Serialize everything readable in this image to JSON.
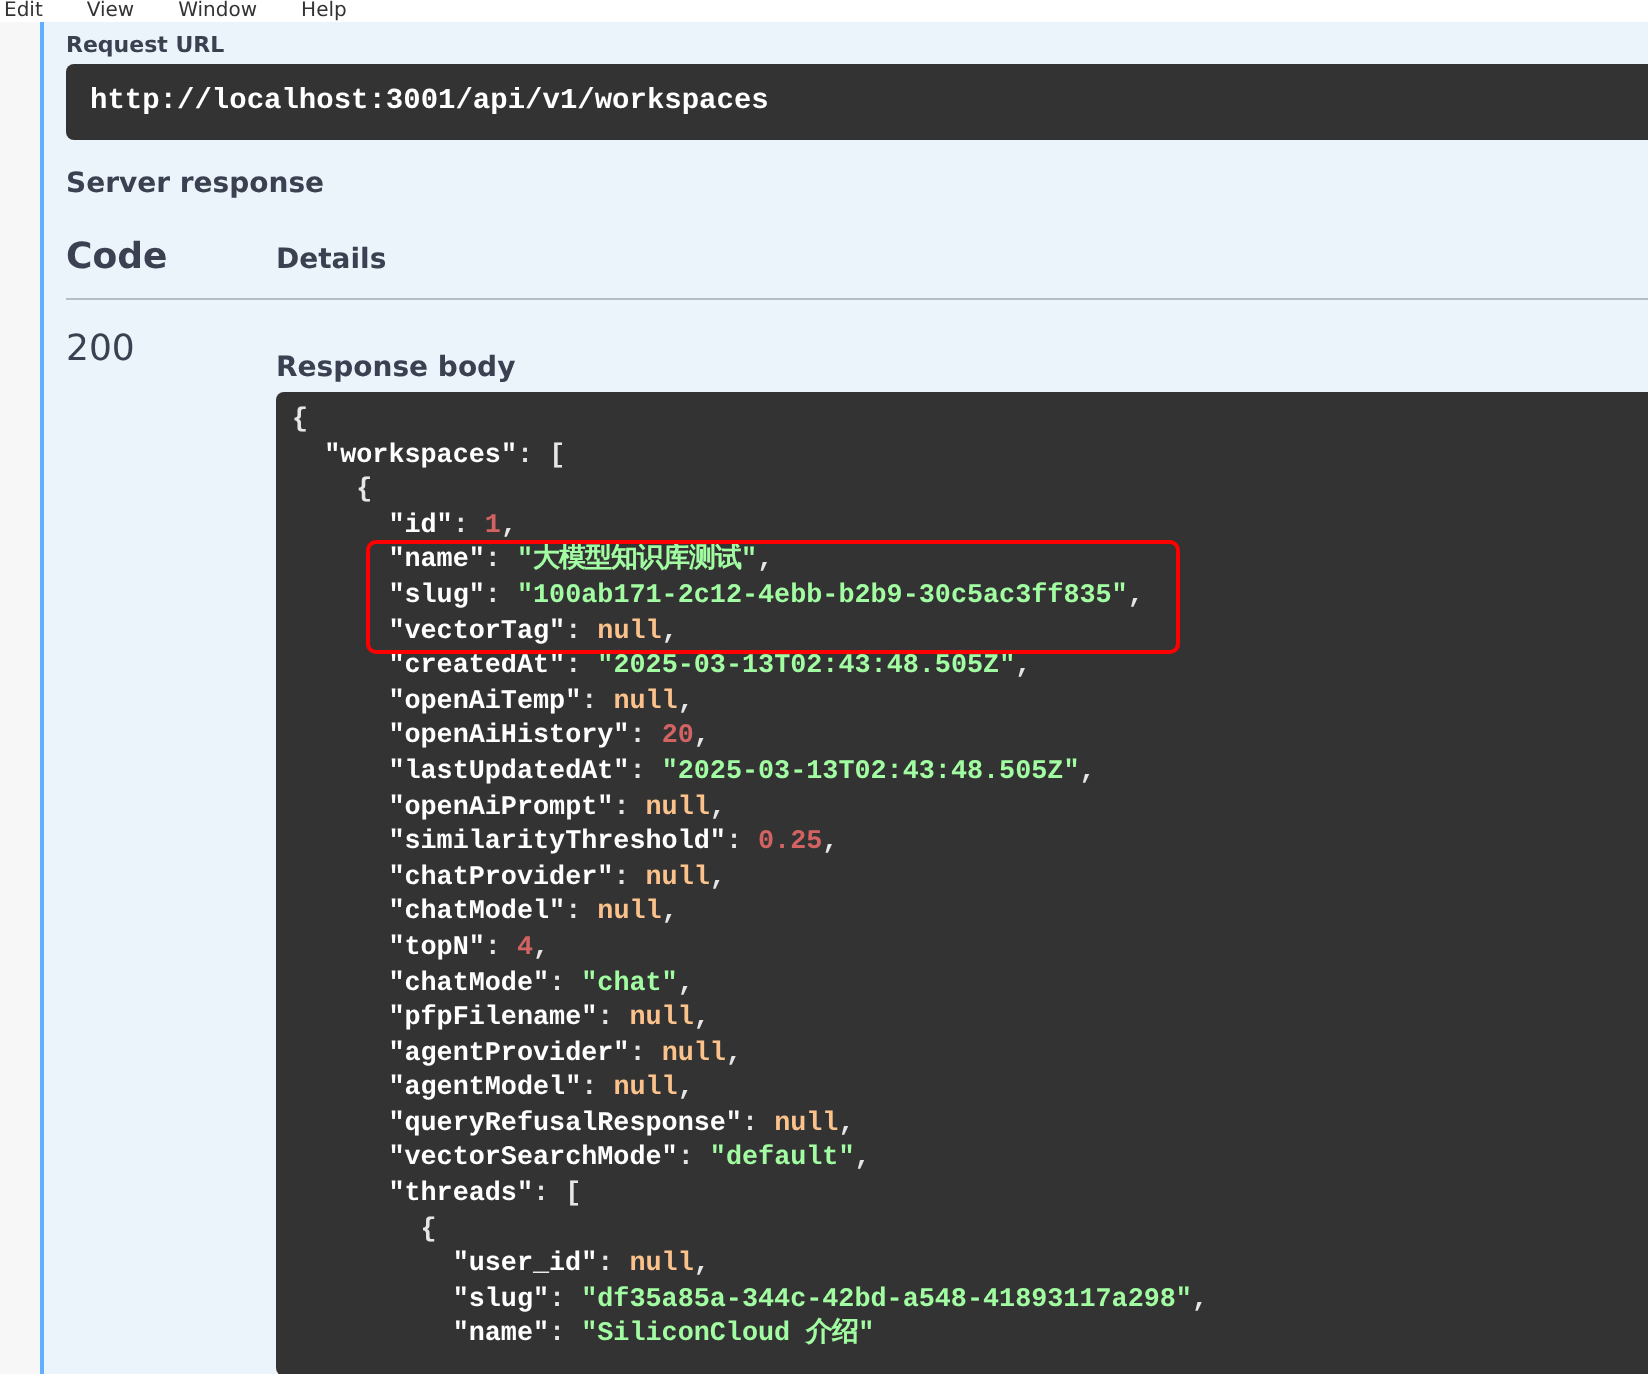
{
  "menu": [
    "Edit",
    "View",
    "Window",
    "Help"
  ],
  "request_url": {
    "label": "Request URL",
    "value": "http://localhost:3001/api/v1/workspaces"
  },
  "server_response": {
    "title": "Server response",
    "columns": [
      "Code",
      "Details"
    ],
    "rows": [
      {
        "code": "200",
        "body_label": "Response body",
        "body": [
          {
            "tokens": [
              {
                "kind": "punct",
                "text": "{"
              }
            ],
            "children": [
              {
                "tokens": [
                  {
                    "kind": "key",
                    "text": "\"workspaces\""
                  },
                  {
                    "kind": "punct",
                    "text": ": ["
                  }
                ],
                "children": [
                  {
                    "tokens": [
                      {
                        "kind": "punct",
                        "text": "{"
                      }
                    ],
                    "children": [
                      {
                        "tokens": [
                          {
                            "kind": "key",
                            "text": "\"id\""
                          },
                          {
                            "kind": "punct",
                            "text": ": "
                          },
                          {
                            "kind": "number",
                            "text": "1"
                          },
                          {
                            "kind": "punct",
                            "text": ","
                          }
                        ],
                        "highlight": false
                      },
                      {
                        "tokens": [
                          {
                            "kind": "key",
                            "text": "\"name\""
                          },
                          {
                            "kind": "punct",
                            "text": ": "
                          },
                          {
                            "kind": "string",
                            "text": "\"大模型知识库测试\""
                          },
                          {
                            "kind": "punct",
                            "text": ","
                          }
                        ],
                        "highlight": true
                      },
                      {
                        "tokens": [
                          {
                            "kind": "key",
                            "text": "\"slug\""
                          },
                          {
                            "kind": "punct",
                            "text": ": "
                          },
                          {
                            "kind": "string",
                            "text": "\"100ab171-2c12-4ebb-b2b9-30c5ac3ff835\""
                          },
                          {
                            "kind": "punct",
                            "text": ","
                          }
                        ],
                        "highlight": true
                      },
                      {
                        "tokens": [
                          {
                            "kind": "key",
                            "text": "\"vectorTag\""
                          },
                          {
                            "kind": "punct",
                            "text": ": "
                          },
                          {
                            "kind": "null",
                            "text": "null"
                          },
                          {
                            "kind": "punct",
                            "text": ","
                          }
                        ],
                        "highlight": true
                      },
                      {
                        "tokens": [
                          {
                            "kind": "key",
                            "text": "\"createdAt\""
                          },
                          {
                            "kind": "punct",
                            "text": ": "
                          },
                          {
                            "kind": "string",
                            "text": "\"2025-03-13T02:43:48.505Z\""
                          },
                          {
                            "kind": "punct",
                            "text": ","
                          }
                        ],
                        "highlight": false
                      },
                      {
                        "tokens": [
                          {
                            "kind": "key",
                            "text": "\"openAiTemp\""
                          },
                          {
                            "kind": "punct",
                            "text": ": "
                          },
                          {
                            "kind": "null",
                            "text": "null"
                          },
                          {
                            "kind": "punct",
                            "text": ","
                          }
                        ],
                        "highlight": false
                      },
                      {
                        "tokens": [
                          {
                            "kind": "key",
                            "text": "\"openAiHistory\""
                          },
                          {
                            "kind": "punct",
                            "text": ": "
                          },
                          {
                            "kind": "number",
                            "text": "20"
                          },
                          {
                            "kind": "punct",
                            "text": ","
                          }
                        ],
                        "highlight": false
                      },
                      {
                        "tokens": [
                          {
                            "kind": "key",
                            "text": "\"lastUpdatedAt\""
                          },
                          {
                            "kind": "punct",
                            "text": ": "
                          },
                          {
                            "kind": "string",
                            "text": "\"2025-03-13T02:43:48.505Z\""
                          },
                          {
                            "kind": "punct",
                            "text": ","
                          }
                        ],
                        "highlight": false
                      },
                      {
                        "tokens": [
                          {
                            "kind": "key",
                            "text": "\"openAiPrompt\""
                          },
                          {
                            "kind": "punct",
                            "text": ": "
                          },
                          {
                            "kind": "null",
                            "text": "null"
                          },
                          {
                            "kind": "punct",
                            "text": ","
                          }
                        ],
                        "highlight": false
                      },
                      {
                        "tokens": [
                          {
                            "kind": "key",
                            "text": "\"similarityThreshold\""
                          },
                          {
                            "kind": "punct",
                            "text": ": "
                          },
                          {
                            "kind": "number",
                            "text": "0.25"
                          },
                          {
                            "kind": "punct",
                            "text": ","
                          }
                        ],
                        "highlight": false
                      },
                      {
                        "tokens": [
                          {
                            "kind": "key",
                            "text": "\"chatProvider\""
                          },
                          {
                            "kind": "punct",
                            "text": ": "
                          },
                          {
                            "kind": "null",
                            "text": "null"
                          },
                          {
                            "kind": "punct",
                            "text": ","
                          }
                        ],
                        "highlight": false
                      },
                      {
                        "tokens": [
                          {
                            "kind": "key",
                            "text": "\"chatModel\""
                          },
                          {
                            "kind": "punct",
                            "text": ": "
                          },
                          {
                            "kind": "null",
                            "text": "null"
                          },
                          {
                            "kind": "punct",
                            "text": ","
                          }
                        ],
                        "highlight": false
                      },
                      {
                        "tokens": [
                          {
                            "kind": "key",
                            "text": "\"topN\""
                          },
                          {
                            "kind": "punct",
                            "text": ": "
                          },
                          {
                            "kind": "number",
                            "text": "4"
                          },
                          {
                            "kind": "punct",
                            "text": ","
                          }
                        ],
                        "highlight": false
                      },
                      {
                        "tokens": [
                          {
                            "kind": "key",
                            "text": "\"chatMode\""
                          },
                          {
                            "kind": "punct",
                            "text": ": "
                          },
                          {
                            "kind": "string",
                            "text": "\"chat\""
                          },
                          {
                            "kind": "punct",
                            "text": ","
                          }
                        ],
                        "highlight": false
                      },
                      {
                        "tokens": [
                          {
                            "kind": "key",
                            "text": "\"pfpFilename\""
                          },
                          {
                            "kind": "punct",
                            "text": ": "
                          },
                          {
                            "kind": "null",
                            "text": "null"
                          },
                          {
                            "kind": "punct",
                            "text": ","
                          }
                        ],
                        "highlight": false
                      },
                      {
                        "tokens": [
                          {
                            "kind": "key",
                            "text": "\"agentProvider\""
                          },
                          {
                            "kind": "punct",
                            "text": ": "
                          },
                          {
                            "kind": "null",
                            "text": "null"
                          },
                          {
                            "kind": "punct",
                            "text": ","
                          }
                        ],
                        "highlight": false
                      },
                      {
                        "tokens": [
                          {
                            "kind": "key",
                            "text": "\"agentModel\""
                          },
                          {
                            "kind": "punct",
                            "text": ": "
                          },
                          {
                            "kind": "null",
                            "text": "null"
                          },
                          {
                            "kind": "punct",
                            "text": ","
                          }
                        ],
                        "highlight": false
                      },
                      {
                        "tokens": [
                          {
                            "kind": "key",
                            "text": "\"queryRefusalResponse\""
                          },
                          {
                            "kind": "punct",
                            "text": ": "
                          },
                          {
                            "kind": "null",
                            "text": "null"
                          },
                          {
                            "kind": "punct",
                            "text": ","
                          }
                        ],
                        "highlight": false
                      },
                      {
                        "tokens": [
                          {
                            "kind": "key",
                            "text": "\"vectorSearchMode\""
                          },
                          {
                            "kind": "punct",
                            "text": ": "
                          },
                          {
                            "kind": "string",
                            "text": "\"default\""
                          },
                          {
                            "kind": "punct",
                            "text": ","
                          }
                        ],
                        "highlight": false
                      },
                      {
                        "tokens": [
                          {
                            "kind": "key",
                            "text": "\"threads\""
                          },
                          {
                            "kind": "punct",
                            "text": ": ["
                          }
                        ],
                        "highlight": false,
                        "children": [
                          {
                            "tokens": [
                              {
                                "kind": "punct",
                                "text": "{"
                              }
                            ],
                            "children": [
                              {
                                "tokens": [
                                  {
                                    "kind": "key",
                                    "text": "\"user_id\""
                                  },
                                  {
                                    "kind": "punct",
                                    "text": ": "
                                  },
                                  {
                                    "kind": "null",
                                    "text": "null"
                                  },
                                  {
                                    "kind": "punct",
                                    "text": ","
                                  }
                                ],
                                "highlight": false
                              },
                              {
                                "tokens": [
                                  {
                                    "kind": "key",
                                    "text": "\"slug\""
                                  },
                                  {
                                    "kind": "punct",
                                    "text": ": "
                                  },
                                  {
                                    "kind": "string",
                                    "text": "\"df35a85a-344c-42bd-a548-41893117a298\""
                                  },
                                  {
                                    "kind": "punct",
                                    "text": ","
                                  }
                                ],
                                "highlight": false
                              },
                              {
                                "tokens": [
                                  {
                                    "kind": "key",
                                    "text": "\"name\""
                                  },
                                  {
                                    "kind": "punct",
                                    "text": ": "
                                  },
                                  {
                                    "kind": "string",
                                    "text": "\"SiliconCloud 介绍\""
                                  }
                                ],
                                "highlight": false
                              }
                            ]
                          }
                        ]
                      }
                    ]
                  }
                ]
              }
            ]
          }
        ]
      }
    ]
  }
}
